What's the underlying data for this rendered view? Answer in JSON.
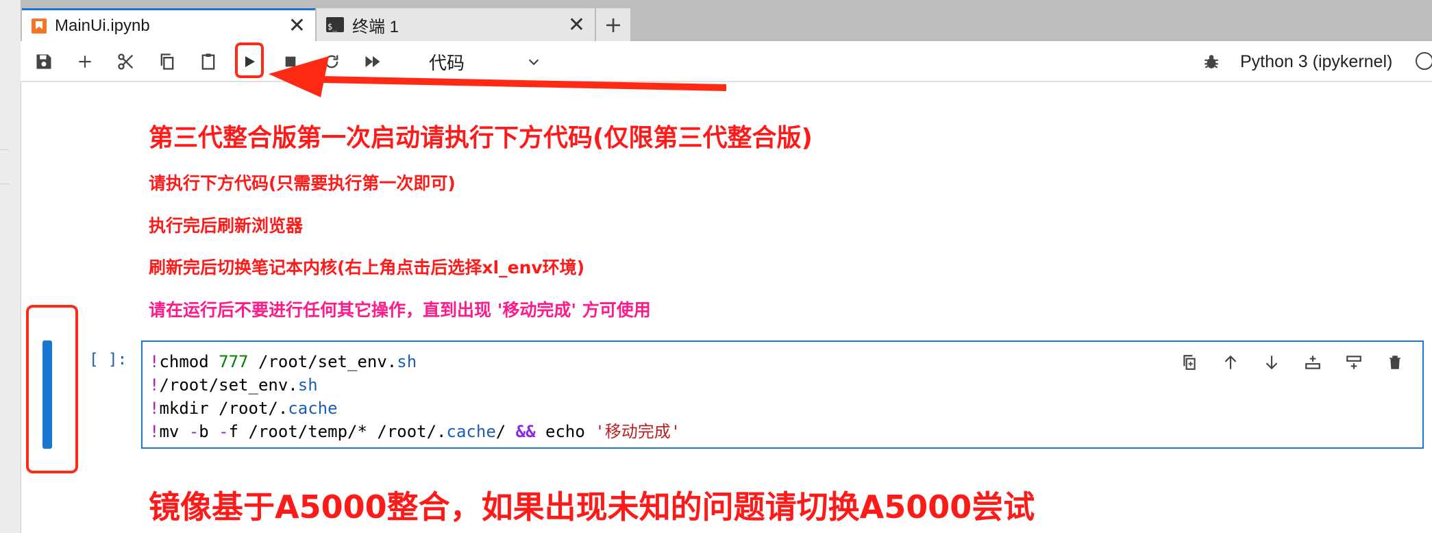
{
  "tabs": [
    {
      "label": "MainUi.ipynb",
      "icon": "notebook-icon",
      "active": true
    },
    {
      "label": "终端 1",
      "icon": "terminal-icon",
      "active": false
    }
  ],
  "toolbar": {
    "cell_type": "代码",
    "kernel_name": "Python 3 (ipykernel)"
  },
  "markdown": {
    "heading": "第三代整合版第一次启动请执行下方代码(仅限第三代整合版)",
    "line1": "请执行下方代码(只需要执行第一次即可)",
    "line2": "执行完后刷新浏览器",
    "line3": "刷新完后切换笔记本内核(右上角点击后选择xl_env环境)",
    "line4": "请在运行后不要进行任何其它操作，直到出现 '移动完成' 方可使用",
    "footer": "镜像基于A5000整合，如果出现未知的问题请切换A5000尝试"
  },
  "cell": {
    "prompt": "[ ]:",
    "lines": [
      "!chmod 777 /root/set_env.sh",
      "!/root/set_env.sh",
      "!mkdir /root/.cache",
      "!mv -b -f /root/temp/* /root/.cache/ && echo '移动完成'"
    ]
  },
  "colors": {
    "accent": "#1976d2",
    "annotation": "#ff2a14",
    "markdown_text": "#ff1a1a",
    "markdown_pink": "#ff1a8c"
  }
}
